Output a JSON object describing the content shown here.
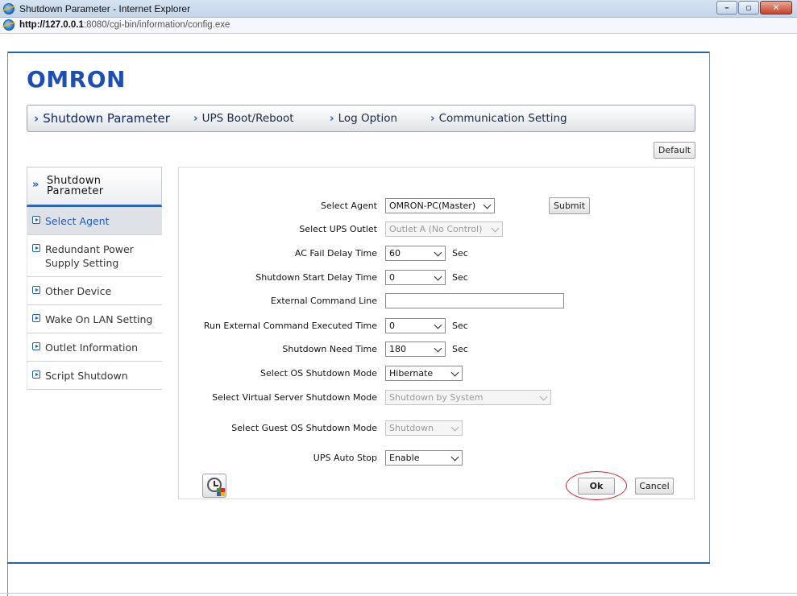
{
  "window": {
    "title": "Shutdown Parameter - Internet Explorer",
    "url_host": "http://127.0.0.1",
    "url_rest": ":8080/cgi-bin/information/config.exe",
    "minimize_icon": "minimize-icon",
    "maximize_icon": "maximize-icon",
    "close_icon": "close-icon"
  },
  "brand": {
    "logo": "OMRON",
    "color": "#1d4fb3"
  },
  "topnav": {
    "chevron": "›",
    "items": [
      {
        "label": "Shutdown Parameter",
        "active": true
      },
      {
        "label": "UPS Boot/Reboot"
      },
      {
        "label": "Log Option"
      },
      {
        "label": "Communication Setting"
      }
    ]
  },
  "default_button": "Default",
  "sidemenu": {
    "header_icon": "»",
    "title": "Shutdown\nParameter",
    "items": [
      {
        "label": "Select Agent",
        "active": true
      },
      {
        "label": "Redundant Power Supply Setting"
      },
      {
        "label": "Other Device"
      },
      {
        "label": "Wake On LAN Setting"
      },
      {
        "label": "Outlet Information"
      },
      {
        "label": "Script Shutdown"
      }
    ]
  },
  "form": {
    "select_agent": {
      "label": "Select Agent",
      "value": "OMRON-PC(Master)"
    },
    "submit": "Submit",
    "ups_outlet": {
      "label": "Select UPS Outlet",
      "value": "Outlet A (No Control)"
    },
    "ac_fail_delay": {
      "label": "AC Fail Delay Time",
      "value": "60",
      "unit": "Sec"
    },
    "shutdown_start_delay": {
      "label": "Shutdown Start Delay Time",
      "value": "0",
      "unit": "Sec"
    },
    "external_command": {
      "label": "External Command Line",
      "value": ""
    },
    "run_external_time": {
      "label": "Run External Command Executed Time",
      "value": "0",
      "unit": "Sec"
    },
    "shutdown_need_time": {
      "label": "Shutdown Need Time",
      "value": "180",
      "unit": "Sec"
    },
    "os_shutdown_mode": {
      "label": "Select OS Shutdown Mode",
      "value": "Hibernate"
    },
    "virtual_server_mode": {
      "label": "Select Virtual Server Shutdown Mode",
      "value": "Shutdown by System"
    },
    "guest_os_mode": {
      "label": "Select Guest OS Shutdown Mode",
      "value": "Shutdown"
    },
    "ups_auto_stop": {
      "label": "UPS Auto Stop",
      "value": "Enable"
    },
    "ok": "Ok",
    "cancel": "Cancel",
    "schedule_icon": "clock-schedule-icon"
  },
  "highlight_color": "#d9232a"
}
